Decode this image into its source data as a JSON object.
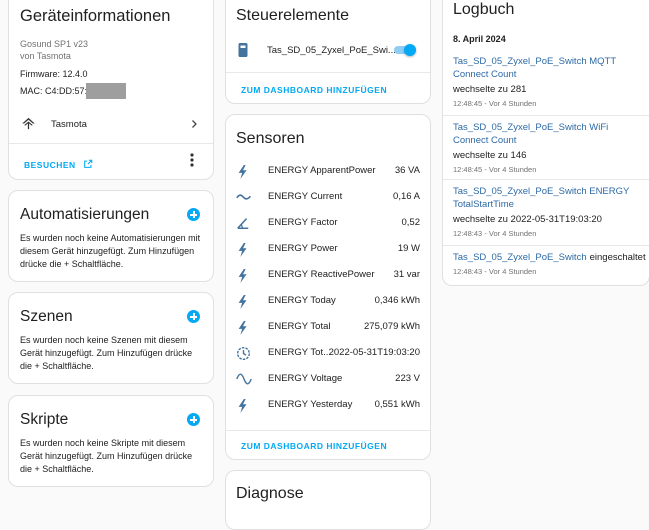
{
  "device_info": {
    "title": "Geräteinformationen",
    "model": "Gosund SP1 v23",
    "manufacturer": "von Tasmota",
    "firmware": "Firmware: 12.4.0",
    "mac": "MAC: C4:DD:57:",
    "integration": "Tasmota",
    "visit_label": "BESUCHEN"
  },
  "automations": {
    "title": "Automatisierungen",
    "text": "Es wurden noch keine Automatisierungen mit diesem Gerät hinzugefügt. Zum Hinzufügen drücke die + Schaltfläche."
  },
  "scenes": {
    "title": "Szenen",
    "text": "Es wurden noch keine Szenen mit diesem Gerät hinzugefügt. Zum Hinzufügen drücke die + Schaltfläche."
  },
  "scripts": {
    "title": "Skripte",
    "text": "Es wurden noch keine Skripte mit diesem Gerät hinzugefügt. Zum Hinzufügen drücke die + Schaltfläche."
  },
  "controls": {
    "title": "Steuerelemente",
    "switch_label": "Tas_SD_05_Zyxel_PoE_Swi...",
    "switch_on": true,
    "add_label": "ZUM DASHBOARD HINZUFÜGEN"
  },
  "sensors": {
    "title": "Sensoren",
    "items": [
      {
        "name": "ENERGY ApparentPower",
        "value": "36 VA",
        "icon": "flash-icon"
      },
      {
        "name": "ENERGY Current",
        "value": "0,16 A",
        "icon": "current-ac-icon"
      },
      {
        "name": "ENERGY Factor",
        "value": "0,52",
        "icon": "angle-icon"
      },
      {
        "name": "ENERGY Power",
        "value": "19 W",
        "icon": "flash-icon"
      },
      {
        "name": "ENERGY ReactivePower",
        "value": "31 var",
        "icon": "flash-icon"
      },
      {
        "name": "ENERGY Today",
        "value": "0,346 kWh",
        "icon": "flash-icon"
      },
      {
        "name": "ENERGY Total",
        "value": "275,079 kWh",
        "icon": "flash-icon"
      },
      {
        "name": "ENERGY Tot...",
        "value": "2022-05-31T19:03:20",
        "icon": "clock-icon"
      },
      {
        "name": "ENERGY Voltage",
        "value": "223 V",
        "icon": "sine-wave-icon"
      },
      {
        "name": "ENERGY Yesterday",
        "value": "0,551 kWh",
        "icon": "flash-icon"
      }
    ],
    "add_label": "ZUM DASHBOARD HINZUFÜGEN"
  },
  "diagnostics": {
    "title": "Diagnose"
  },
  "logbook": {
    "title": "Logbuch",
    "date": "8. April 2024",
    "entries": [
      {
        "entity": "Tas_SD_05_Zyxel_PoE_Switch MQTT Connect Count",
        "message": "wechselte zu 281",
        "time": "12:48:45 - Vor 4 Stunden"
      },
      {
        "entity": "Tas_SD_05_Zyxel_PoE_Switch WiFi Connect Count",
        "message": "wechselte zu 146",
        "time": "12:48:45 - Vor 4 Stunden"
      },
      {
        "entity": "Tas_SD_05_Zyxel_PoE_Switch ENERGY TotalStartTime",
        "message": "wechselte zu 2022-05-31T19:03:20",
        "time": "12:48:43 - Vor 4 Stunden"
      },
      {
        "entity": "Tas_SD_05_Zyxel_PoE_Switch",
        "message": "eingeschaltet",
        "time": "12:48:43 - Vor 4 Stunden"
      }
    ]
  },
  "colors": {
    "accent": "#03a9f4",
    "link": "#2d6aa6",
    "icon": "#44739e"
  }
}
